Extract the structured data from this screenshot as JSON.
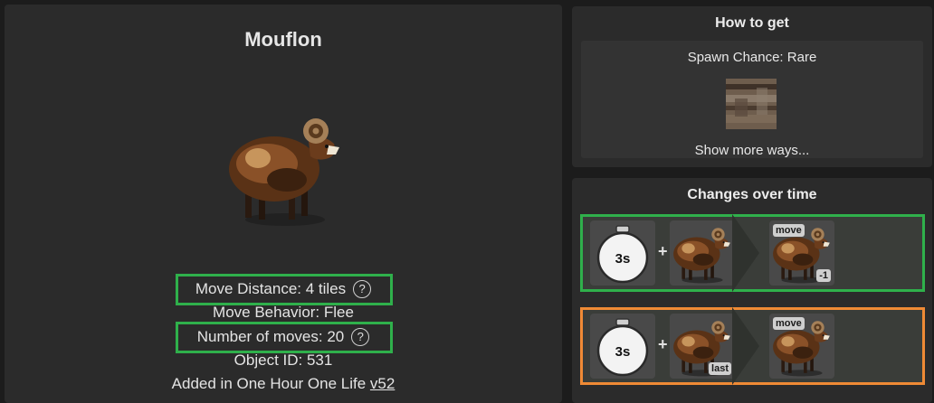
{
  "object": {
    "title": "Mouflon",
    "image_icon": "mouflon-sprite",
    "move_distance": "Move Distance: 4 tiles",
    "move_behavior": "Move Behavior: Flee",
    "number_of_moves": "Number of moves: 20",
    "object_id": "Object ID: 531",
    "added_prefix": "Added in One Hour One Life ",
    "added_version": "v52",
    "help_glyph": "?"
  },
  "how_to_get": {
    "title": "How to get",
    "spawn": "Spawn Chance: Rare",
    "biome_icon": "biome-rock-texture",
    "show_more": "Show more ways..."
  },
  "changes": {
    "title": "Changes over time",
    "transitions": [
      {
        "timer": "3s",
        "plus": "+",
        "actor_icon": "mouflon-icon",
        "actor_tag": "",
        "result_tag": "move",
        "result_badge": "-1"
      },
      {
        "timer": "3s",
        "plus": "+",
        "actor_icon": "mouflon-icon",
        "actor_tag": "last",
        "result_tag": "move",
        "result_badge": ""
      }
    ]
  },
  "colors": {
    "highlight_green": "#2fb04b",
    "highlight_orange": "#ef8a35",
    "panel_bg": "#2b2b2b",
    "page_bg": "#1c1c1c"
  }
}
